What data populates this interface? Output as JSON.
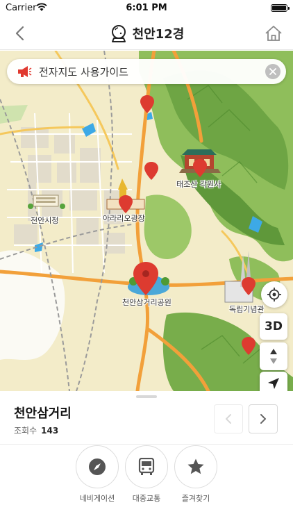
{
  "status_bar": {
    "carrier": "Carrier",
    "time": "6:01 PM"
  },
  "header": {
    "title": "천안12경",
    "icons": {
      "back": "chevron-left-icon",
      "logo": "crystal-ball-icon",
      "home": "home-icon"
    }
  },
  "map": {
    "guide_banner": {
      "text": "전자지도 사용가이드",
      "icon": "megaphone-icon"
    },
    "labels": {
      "city_hall": "천안시청",
      "arario_plaza": "아라리오광장",
      "taejosan": "태조산 각원사",
      "samgeori_park": "천안삼거리공원",
      "independence_hall": "독립기념관"
    },
    "controls": {
      "three_d": "3D"
    },
    "colors": {
      "land": "#f3ecc9",
      "mountain": "#7cae4f",
      "road_major": "#f2a03a",
      "road_minor": "#ffffff",
      "water": "#3da9e6",
      "pin": "#dd3b30"
    }
  },
  "place": {
    "name": "천안삼거리",
    "views_label": "조회수",
    "views": "143"
  },
  "actions": [
    {
      "label": "네비게이션",
      "icon": "compass-icon"
    },
    {
      "label": "대중교통",
      "icon": "bus-icon"
    },
    {
      "label": "즐겨찾기",
      "icon": "star-icon"
    }
  ]
}
